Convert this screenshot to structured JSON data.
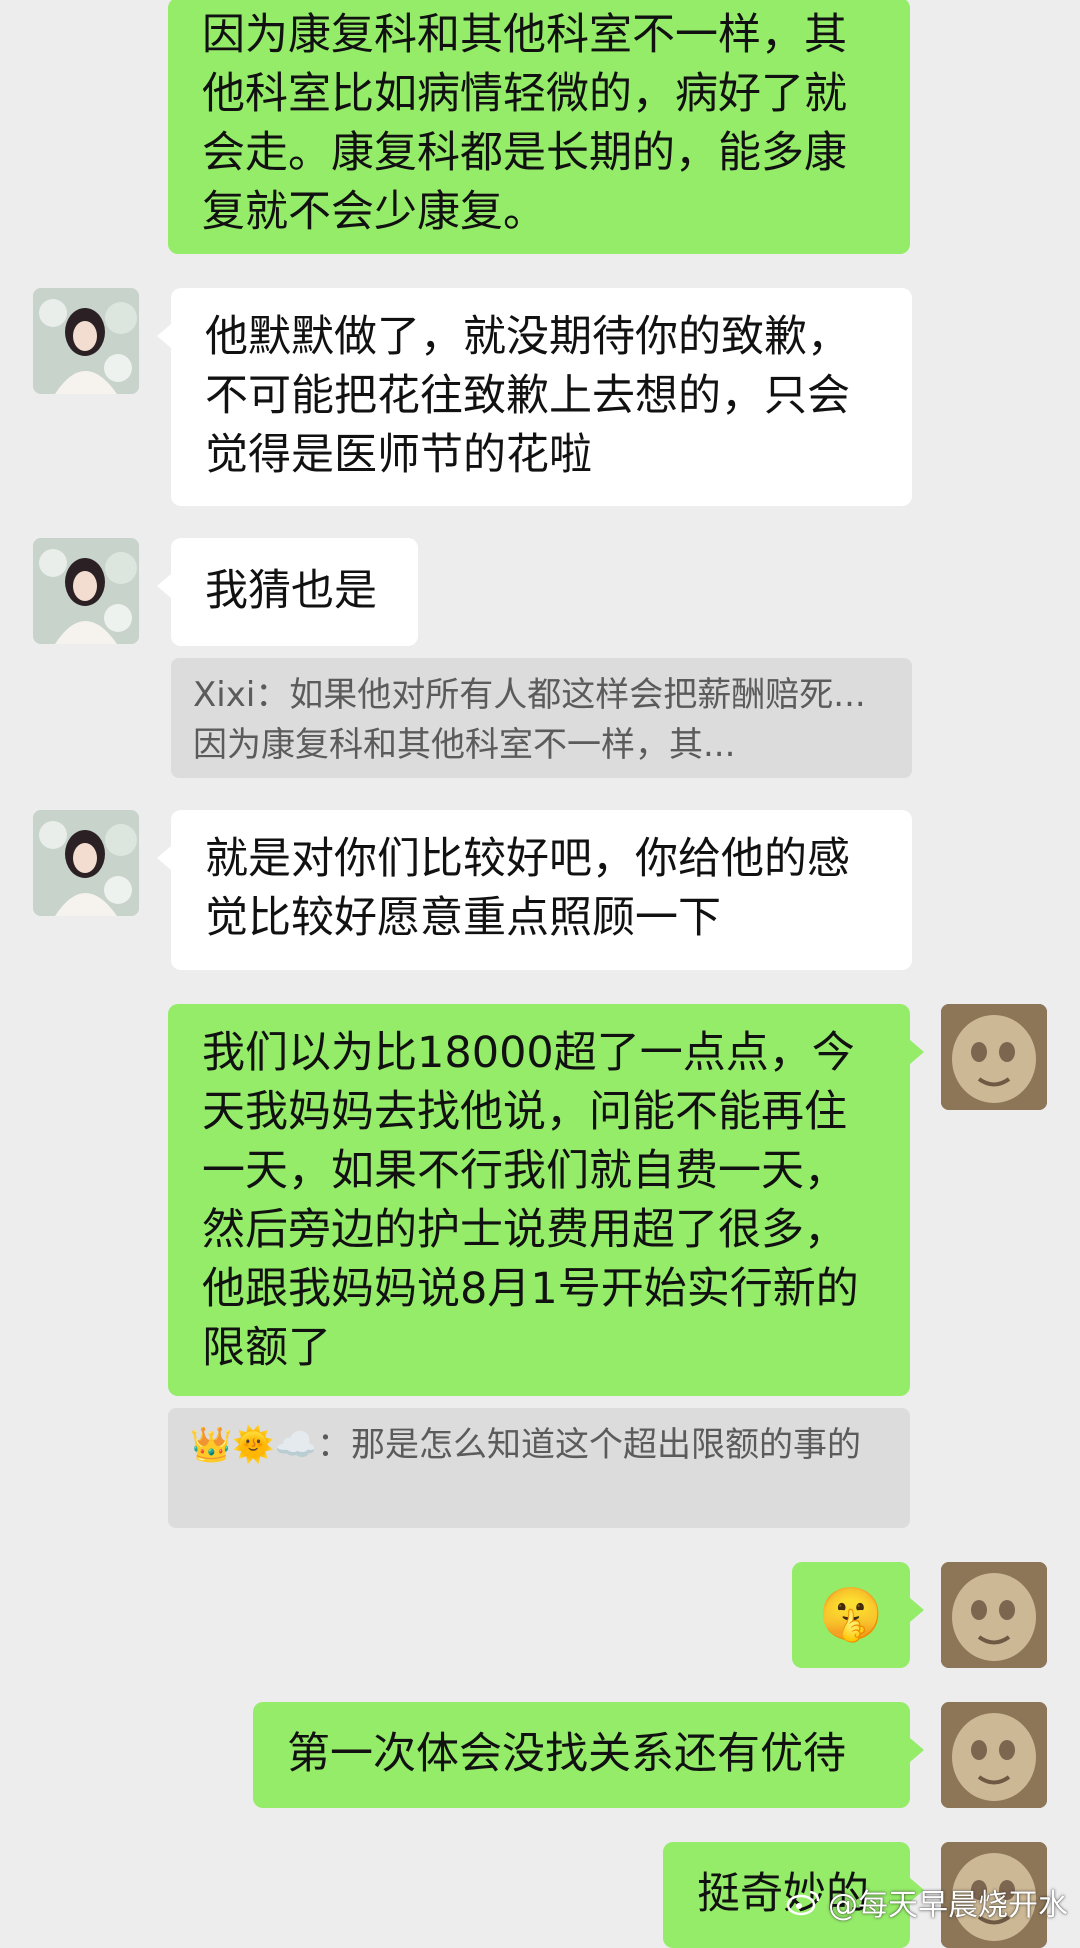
{
  "messages": [
    {
      "sender": "me",
      "text": "因为康复科和其他科室不一样，其他科室比如病情轻微的，病好了就会走。康复科都是长期的，能多康复就不会少康复。"
    },
    {
      "sender": "other",
      "text": "他默默做了，就没期待你的致歉，不可能把花往致歉上去想的，只会觉得是医师节的花啦"
    },
    {
      "sender": "other",
      "text": "我猜也是"
    },
    {
      "sender": "quote",
      "text": "Xixi：如果他对所有人都这样会把薪酬赔死... 因为康复科和其他科室不一样，其..."
    },
    {
      "sender": "other",
      "text": "就是对你们比较好吧，你给他的感觉比较好愿意重点照顾一下"
    },
    {
      "sender": "me",
      "text": "我们以为比18000超了一点点，今天我妈妈去找他说，问能不能再住一天，如果不行我们就自费一天，然后旁边的护士说费用超了很多，他跟我妈妈说8月1号开始实行新的限额了"
    },
    {
      "sender": "quote",
      "text": "👑🌞☁️：那是怎么知道这个超出限额的事的"
    },
    {
      "sender": "me",
      "text": "🤫"
    },
    {
      "sender": "me",
      "text": "第一次体会没找关系还有优待"
    },
    {
      "sender": "me",
      "text": "挺奇妙的"
    }
  ],
  "watermark": "@每天早晨烧开水",
  "colors": {
    "background": "#ededed",
    "sent_bubble": "#95ec69",
    "received_bubble": "#ffffff",
    "quote": "#dcdcdc"
  }
}
